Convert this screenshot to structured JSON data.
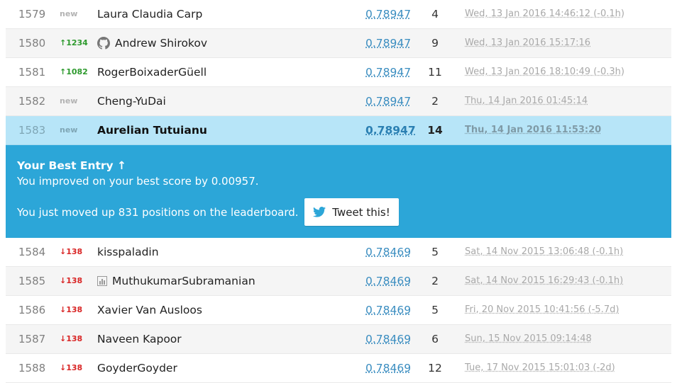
{
  "leaderboard": {
    "rows": [
      {
        "rank": "1579",
        "delta": "new",
        "delta_type": "new",
        "name": "Laura Claudia Carp",
        "icon": "",
        "score": "0.78947",
        "entries": "4",
        "last": "Wed, 13 Jan 2016 14:46:12 (-0.1h)"
      },
      {
        "rank": "1580",
        "delta": "↑1234",
        "delta_type": "up",
        "name": "Andrew Shirokov",
        "icon": "github-icon",
        "score": "0.78947",
        "entries": "9",
        "last": "Wed, 13 Jan 2016 15:17:16"
      },
      {
        "rank": "1581",
        "delta": "↑1082",
        "delta_type": "up",
        "name": "RogerBoixaderGüell",
        "icon": "",
        "score": "0.78947",
        "entries": "11",
        "last": "Wed, 13 Jan 2016 18:10:49 (-0.3h)"
      },
      {
        "rank": "1582",
        "delta": "new",
        "delta_type": "new",
        "name": "Cheng-YuDai",
        "icon": "",
        "score": "0.78947",
        "entries": "2",
        "last": "Thu, 14 Jan 2016 01:45:14"
      },
      {
        "rank": "1583",
        "delta": "new",
        "delta_type": "new",
        "name": "Aurelian Tutuianu",
        "icon": "",
        "score": "0.78947",
        "entries": "14",
        "last": "Thu, 14 Jan 2016 11:53:20"
      }
    ],
    "rows_after": [
      {
        "rank": "1584",
        "delta": "↓138",
        "delta_type": "down",
        "name": "kisspaladin",
        "icon": "",
        "score": "0.78469",
        "entries": "5",
        "last": "Sat, 14 Nov 2015 13:06:48 (-0.1h)"
      },
      {
        "rank": "1585",
        "delta": "↓138",
        "delta_type": "down",
        "name": "MuthukumarSubramanian",
        "icon": "chart-icon",
        "score": "0.78469",
        "entries": "2",
        "last": "Sat, 14 Nov 2015 16:29:43 (-0.1h)"
      },
      {
        "rank": "1586",
        "delta": "↓138",
        "delta_type": "down",
        "name": "Xavier Van Ausloos",
        "icon": "",
        "score": "0.78469",
        "entries": "5",
        "last": "Fri, 20 Nov 2015 10:41:56 (-5.7d)"
      },
      {
        "rank": "1587",
        "delta": "↓138",
        "delta_type": "down",
        "name": "Naveen Kapoor",
        "icon": "",
        "score": "0.78469",
        "entries": "6",
        "last": "Sun, 15 Nov 2015 09:14:48"
      },
      {
        "rank": "1588",
        "delta": "↓138",
        "delta_type": "down",
        "name": "GoyderGoyder",
        "icon": "",
        "score": "0.78469",
        "entries": "12",
        "last": "Tue, 17 Nov 2015 15:01:03 (-2d)"
      }
    ]
  },
  "best_entry": {
    "title": "Your Best Entry ↑",
    "improved": "You improved on your best score by 0.00957.",
    "moved": "You just moved up 831 positions on the leaderboard.",
    "tweet_label": "Tweet this!",
    "tweet_icon": "twitter-bird-icon"
  },
  "colors": {
    "highlight_row": "#b7e5f8",
    "banner": "#2ca6d8",
    "score_link": "#3a8dc0",
    "up": "#2e9a2e",
    "down": "#d92626"
  }
}
